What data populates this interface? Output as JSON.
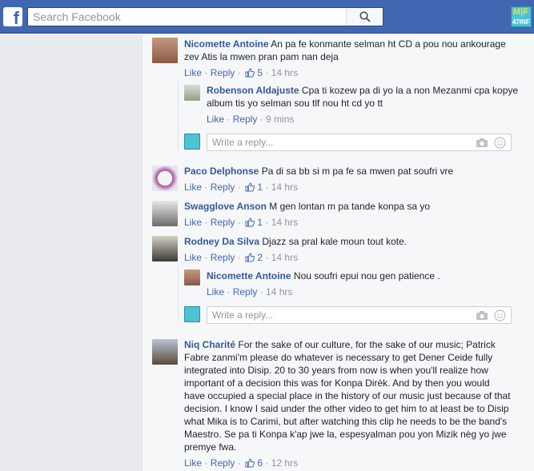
{
  "header": {
    "search_placeholder": "Search Facebook",
    "logo_letter": "f",
    "brand_line1": "M|F",
    "brand_line2": "47INF"
  },
  "reply_placeholder": "Write a reply...",
  "comments": [
    {
      "name": "Nicomette Antoine",
      "text": "An pa fe konmante selman ht CD a pou nou ankourage zev Atis la mwen pran pam nan deja",
      "like": "Like",
      "reply": "Reply",
      "likes": "5",
      "time": "14 hrs",
      "replies": [
        {
          "name": "Robenson Aldajuste",
          "text": "Cpa ti kozew pa di yo la a non Mezanmi cpa kopye album tis yo selman sou tlf nou ht cd yo tt",
          "like": "Like",
          "reply": "Reply",
          "time": "9 mins"
        }
      ]
    },
    {
      "name": "Paco Delphonse",
      "text": "Pa di sa bb si m pa fe sa mwen pat soufri vre",
      "like": "Like",
      "reply": "Reply",
      "likes": "1",
      "time": "14 hrs"
    },
    {
      "name": "Swagglove Anson",
      "text": "M gen lontan m pa tande konpa sa yo",
      "like": "Like",
      "reply": "Reply",
      "likes": "1",
      "time": "14 hrs"
    },
    {
      "name": "Rodney Da Silva",
      "text": "Djazz sa pral kale moun tout kote.",
      "like": "Like",
      "reply": "Reply",
      "likes": "2",
      "time": "14 hrs",
      "replies": [
        {
          "name": "Nicomette Antoine",
          "text": "Nou soufri epui nou gen patience .",
          "like": "Like",
          "reply": "Reply",
          "time": "14 hrs"
        }
      ]
    },
    {
      "name": "Niq Charité",
      "text": "For the sake of our culture, for the sake of our music; Patrick Fabre zanmi'm please do whatever is necessary to get Dener Ceide fully integrated into Disip. 20 to 30 years from now is when you'll realize how important of a decision this was for Konpa Dirèk. And by then you would have occupied a special place in the history of our music just because of that decision. I know I said under the other video to get him to at least be to Disip what Mika is to Carimi, but after watching this clip he needs to be the band's Maestro. Se pa ti Konpa k'ap jwe la, espesyalman pou yon Mizik nèg yo jwe premye fwa.",
      "like": "Like",
      "reply": "Reply",
      "likes": "6",
      "time": "12 hrs"
    }
  ],
  "colors": {
    "header_bg": "#4267b2",
    "link": "#365899",
    "meta": "#90949c",
    "feed_bg": "#f6f7f9",
    "left_bg": "#e9ebee"
  }
}
